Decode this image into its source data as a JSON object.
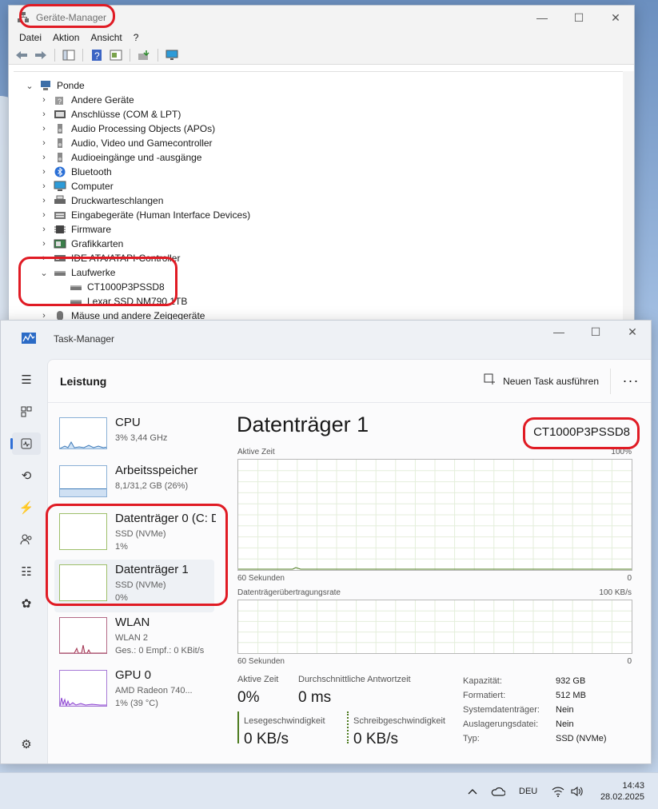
{
  "device_manager": {
    "title": "Geräte-Manager",
    "menu": [
      "Datei",
      "Aktion",
      "Ansicht",
      "?"
    ],
    "root": "Ponde",
    "categories": [
      {
        "label": "Andere Geräte",
        "icon": "unknown-device-icon"
      },
      {
        "label": "Anschlüsse (COM & LPT)",
        "icon": "port-icon"
      },
      {
        "label": "Audio Processing Objects (APOs)",
        "icon": "speaker-icon"
      },
      {
        "label": "Audio, Video und Gamecontroller",
        "icon": "speaker-icon"
      },
      {
        "label": "Audioeingänge und -ausgänge",
        "icon": "speaker-icon"
      },
      {
        "label": "Bluetooth",
        "icon": "bluetooth-icon"
      },
      {
        "label": "Computer",
        "icon": "monitor-icon"
      },
      {
        "label": "Druckwarteschlangen",
        "icon": "printer-icon"
      },
      {
        "label": "Eingabegeräte (Human Interface Devices)",
        "icon": "hid-icon"
      },
      {
        "label": "Firmware",
        "icon": "chip-icon"
      },
      {
        "label": "Grafikkarten",
        "icon": "display-adapter-icon"
      },
      {
        "label": "IDE ATA/ATAPI-Controller",
        "icon": "controller-icon"
      },
      {
        "label": "Laufwerke",
        "icon": "disk-drive-icon",
        "expanded": true,
        "children": [
          "CT1000P3PSSD8",
          "Lexar SSD NM790 1TB"
        ]
      },
      {
        "label": "Mäuse und andere Zeigegeräte",
        "icon": "mouse-icon"
      }
    ]
  },
  "task_manager": {
    "title": "Task-Manager",
    "section": "Leistung",
    "new_task": "Neuen Task ausführen",
    "more": "···",
    "resources": [
      {
        "name": "CPU",
        "sub1": "3% 3,44 GHz",
        "sub2": ""
      },
      {
        "name": "Arbeitsspeicher",
        "sub1": "8,1/31,2 GB (26%)",
        "sub2": ""
      },
      {
        "name": "Datenträger 0 (C: D",
        "sub1": "SSD (NVMe)",
        "sub2": "1%"
      },
      {
        "name": "Datenträger 1",
        "sub1": "SSD (NVMe)",
        "sub2": "0%"
      },
      {
        "name": "WLAN",
        "sub1": "WLAN 2",
        "sub2": "Ges.: 0 Empf.: 0 KBit/s"
      },
      {
        "name": "GPU 0",
        "sub1": "AMD Radeon 740...",
        "sub2": "1% (39 °C)"
      }
    ],
    "memory_fill_fraction": 0.26,
    "detail": {
      "title": "Datenträger 1",
      "model": "CT1000P3PSSD8",
      "graph1_label": "Aktive Zeit",
      "graph1_max": "100%",
      "graph1_time": "60 Sekunden",
      "graph1_min": "0",
      "graph2_label": "Datenträgerübertragungsrate",
      "graph2_max": "100 KB/s",
      "graph2_time": "60 Sekunden",
      "graph2_min": "0",
      "active_time_label": "Aktive Zeit",
      "active_time_value": "0%",
      "response_label": "Durchschnittliche Antwortzeit",
      "response_value": "0 ms",
      "read_label": "Lesegeschwindigkeit",
      "read_value": "0 KB/s",
      "write_label": "Schreibgeschwindigkeit",
      "write_value": "0 KB/s",
      "properties": [
        {
          "key": "Kapazität:",
          "value": "932 GB"
        },
        {
          "key": "Formatiert:",
          "value": "512 MB"
        },
        {
          "key": "Systemdatenträger:",
          "value": "Nein"
        },
        {
          "key": "Auslagerungsdatei:",
          "value": "Nein"
        },
        {
          "key": "Typ:",
          "value": "SSD (NVMe)"
        }
      ]
    }
  },
  "taskbar": {
    "language": "DEU",
    "time": "14:43",
    "date": "28.02.2025"
  },
  "colors": {
    "annotation_red": "#e01b24",
    "accent_blue": "#2f6fd6",
    "disk_graph_green": "#4c7a1e",
    "wifi_graph_red": "#a0304e",
    "gpu_graph_purple": "#8a3fd0"
  }
}
